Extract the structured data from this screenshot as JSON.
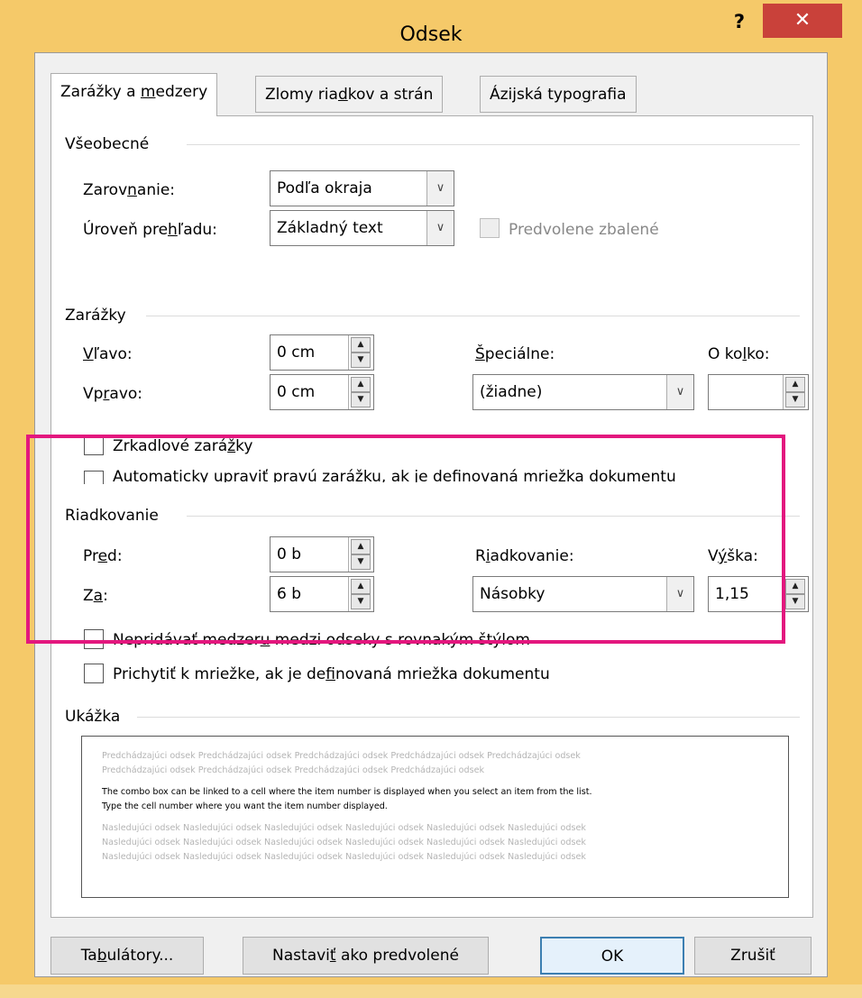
{
  "window": {
    "title": "Odsek",
    "help_label": "?",
    "close_label": "✕"
  },
  "tabs": [
    {
      "pre": "Zarážky a ",
      "acc": "m",
      "post": "edzery"
    },
    {
      "pre": "Zlomy ria",
      "acc": "d",
      "post": "kov a strán"
    },
    {
      "pre": "Ázijská typo",
      "acc": "g",
      "post": "rafia"
    }
  ],
  "general": {
    "heading": "Všeobecné",
    "alignment": {
      "pre": "Zarov",
      "acc": "n",
      "post": "anie:",
      "value": "Podľa okraja"
    },
    "outline": {
      "pre": "Úroveň pre",
      "acc": "h",
      "post": "ľadu:",
      "value": "Základný text"
    },
    "collapsed_label": "Predvolene zbalené"
  },
  "indents": {
    "heading": "Zarážky",
    "left": {
      "pre": "",
      "acc": "V",
      "post": "ľavo:",
      "value": "0 cm"
    },
    "right": {
      "pre": "Vp",
      "acc": "r",
      "post": "avo:",
      "value": "0 cm"
    },
    "special": {
      "pre": "",
      "acc": "Š",
      "post": "peciálne:",
      "value": "(žiadne)"
    },
    "by": {
      "pre": "O ko",
      "acc": "l",
      "post": "ko:",
      "value": ""
    },
    "mirror": {
      "pre": "Zrkadlové zará",
      "acc": "ž",
      "post": "ky"
    },
    "auto": {
      "pre": "Au",
      "acc": "t",
      "post": "omaticky upraviť pravú zarážku, ak je definovaná mriežka dokumentu"
    }
  },
  "spacing": {
    "heading": "Riadkovanie",
    "before": {
      "pre": "Pr",
      "acc": "e",
      "post": "d:",
      "value": "0 b"
    },
    "after": {
      "pre": "Z",
      "acc": "a",
      "post": ":",
      "value": "6 b"
    },
    "line": {
      "pre": "R",
      "acc": "i",
      "post": "adkovanie:",
      "value": "Násobky"
    },
    "at": {
      "pre": "V",
      "acc": "ý",
      "post": "ška:",
      "value": "1,15"
    },
    "dont_add": {
      "pre": "Nepridávať medzer",
      "acc": "u",
      "post": " medzi odseky s rovnakým štýlom"
    },
    "snap": {
      "pre": "Prichytiť k mriežke, ak je de",
      "acc": "f",
      "post": "inovaná mriežka dokumentu"
    }
  },
  "preview": {
    "heading": "Ukážka",
    "prev_lines": [
      "Predchádzajúci odsek Predchádzajúci odsek Predchádzajúci odsek Predchádzajúci odsek Predchádzajúci odsek",
      "Predchádzajúci odsek Predchádzajúci odsek Predchádzajúci odsek Predchádzajúci odsek"
    ],
    "sample_lines": [
      "The combo box can be linked to a cell where the item number is displayed when you select an item from the list.",
      "Type the cell number where you want the item number displayed."
    ],
    "next_lines": [
      "Nasledujúci odsek Nasledujúci odsek Nasledujúci odsek Nasledujúci odsek Nasledujúci odsek Nasledujúci odsek",
      "Nasledujúci odsek Nasledujúci odsek Nasledujúci odsek Nasledujúci odsek Nasledujúci odsek Nasledujúci odsek",
      "Nasledujúci odsek Nasledujúci odsek Nasledujúci odsek Nasledujúci odsek Nasledujúci odsek Nasledujúci odsek"
    ]
  },
  "buttons": {
    "tabs": {
      "pre": "Ta",
      "acc": "b",
      "post": "ulátory..."
    },
    "default": {
      "pre": "Nastavi",
      "acc": "ť",
      "post": " ako predvolené"
    },
    "ok": {
      "pre": "OK",
      "acc": "",
      "post": ""
    },
    "cancel": {
      "pre": "Zrušiť",
      "acc": "",
      "post": ""
    }
  },
  "colors": {
    "highlight": "#e3177e",
    "titlebar": "#f5c969",
    "close": "#c9413a"
  }
}
